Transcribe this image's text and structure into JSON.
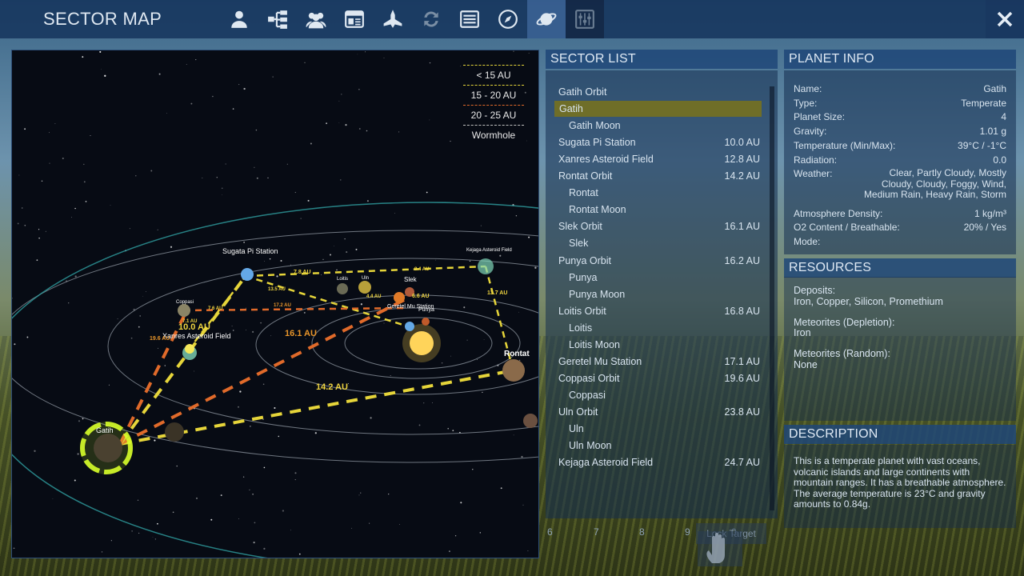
{
  "window": {
    "title": "SECTOR MAP"
  },
  "tabs": [
    {
      "icon": "person-icon"
    },
    {
      "icon": "hierarchy-icon"
    },
    {
      "icon": "crew-icon"
    },
    {
      "icon": "window-icon"
    },
    {
      "icon": "ship-icon"
    },
    {
      "icon": "recycle-icon"
    },
    {
      "icon": "list-icon"
    },
    {
      "icon": "compass-icon"
    },
    {
      "icon": "planet-icon",
      "active": true
    },
    {
      "icon": "sliders-icon"
    }
  ],
  "close_icon": "close-icon",
  "legend": {
    "items": [
      "< 15 AU",
      "15 - 20 AU",
      "20 - 25 AU",
      "Wormhole"
    ],
    "colors": [
      "#e6d53a",
      "#e06a2a",
      "#c0c0c0",
      "#ffffff"
    ]
  },
  "map": {
    "bodies": [
      {
        "name": "Gatih",
        "color": "#6b5a3c"
      },
      {
        "name": "Sugata Pi Station",
        "color": "#64a8e6"
      },
      {
        "name": "Xanres Asteroid Field",
        "color": "#7fd6b8"
      },
      {
        "name": "Coppasi",
        "color": "#8a8466"
      },
      {
        "name": "Loitis",
        "color": "#6a6a55"
      },
      {
        "name": "Uln",
        "color": "#b8a03a"
      },
      {
        "name": "Slek",
        "color": "#e07a28"
      },
      {
        "name": "Geretel Mu Station",
        "color": "#64a8e6"
      },
      {
        "name": "Punya",
        "color": "#c05a2a"
      },
      {
        "name": "Kejaga Asteroid Field",
        "color": "#7fd6b8"
      },
      {
        "name": "Rontat",
        "color": "#8a6a4a"
      }
    ],
    "distance_labels": [
      "10.0 AU",
      "16.1 AU",
      "14.2 AU",
      "7.8 AU",
      "13.7 AU",
      "19.6 AU",
      "4.4 AU",
      "8.4 AU",
      "17.2 AU",
      "13.5 AU",
      "7.6 AU",
      "6.6 AU",
      "7.1 AU"
    ]
  },
  "sector_list": {
    "header": "SECTOR LIST",
    "items": [
      {
        "name": "Gatih Orbit",
        "dist": "",
        "indent": 0
      },
      {
        "name": "Gatih",
        "dist": "",
        "indent": 1,
        "selected": true
      },
      {
        "name": "Gatih Moon",
        "dist": "",
        "indent": 1
      },
      {
        "name": "Sugata Pi Station",
        "dist": "10.0 AU",
        "indent": 0
      },
      {
        "name": "Xanres Asteroid Field",
        "dist": "12.8 AU",
        "indent": 0
      },
      {
        "name": "Rontat Orbit",
        "dist": "14.2 AU",
        "indent": 0
      },
      {
        "name": "Rontat",
        "dist": "",
        "indent": 1
      },
      {
        "name": "Rontat Moon",
        "dist": "",
        "indent": 1
      },
      {
        "name": "Slek Orbit",
        "dist": "16.1 AU",
        "indent": 0
      },
      {
        "name": "Slek",
        "dist": "",
        "indent": 1
      },
      {
        "name": "Punya Orbit",
        "dist": "16.2 AU",
        "indent": 0
      },
      {
        "name": "Punya",
        "dist": "",
        "indent": 1
      },
      {
        "name": "Punya Moon",
        "dist": "",
        "indent": 1
      },
      {
        "name": "Loitis Orbit",
        "dist": "16.8 AU",
        "indent": 0
      },
      {
        "name": "Loitis",
        "dist": "",
        "indent": 1
      },
      {
        "name": "Loitis Moon",
        "dist": "",
        "indent": 1
      },
      {
        "name": "Geretel Mu Station",
        "dist": "17.1 AU",
        "indent": 0
      },
      {
        "name": "Coppasi Orbit",
        "dist": "19.6 AU",
        "indent": 0
      },
      {
        "name": "Coppasi",
        "dist": "",
        "indent": 1
      },
      {
        "name": "Uln Orbit",
        "dist": "23.8 AU",
        "indent": 0
      },
      {
        "name": "Uln",
        "dist": "",
        "indent": 1
      },
      {
        "name": "Uln Moon",
        "dist": "",
        "indent": 1
      },
      {
        "name": "Kejaga Asteroid Field",
        "dist": "24.7 AU",
        "indent": 0
      }
    ],
    "pager": [
      "6",
      "7",
      "8",
      "9",
      "0"
    ],
    "lock_target_label": "Lock Target"
  },
  "planet_info": {
    "header": "PLANET INFO",
    "rows": [
      {
        "key": "Name:",
        "value": "Gatih"
      },
      {
        "key": "Type:",
        "value": "Temperate"
      },
      {
        "key": "Planet Size:",
        "value": "4"
      },
      {
        "key": "Gravity:",
        "value": "1.01 g"
      },
      {
        "key": "Temperature (Min/Max):",
        "value": "39°C / -1°C"
      },
      {
        "key": "Radiation:",
        "value": "0.0"
      },
      {
        "key": "Weather:",
        "value": "Clear, Partly Cloudy, Mostly Cloudy, Cloudy, Foggy, Wind, Medium Rain, Heavy Rain, Storm"
      },
      {
        "key": "Atmosphere Density:",
        "value": "1 kg/m³"
      },
      {
        "key": "O2 Content / Breathable:",
        "value": "20% / Yes"
      },
      {
        "key": "Mode:",
        "value": "",
        "color": "#d04040"
      }
    ]
  },
  "resources": {
    "header": "RESOURCES",
    "deposits_label": "Deposits:",
    "deposits_value": "Iron, Copper, Silicon, Promethium",
    "depletion_label": "Meteorites (Depletion):",
    "depletion_value": "Iron",
    "random_label": "Meteorites (Random):",
    "random_value": "None"
  },
  "description": {
    "header": "DESCRIPTION",
    "text": "This is a temperate planet with vast oceans, volcanic islands and large continents with mountain ranges. It has a breathable atmosphere. The average temperature is 23°C and gravity amounts to 0.84g."
  }
}
